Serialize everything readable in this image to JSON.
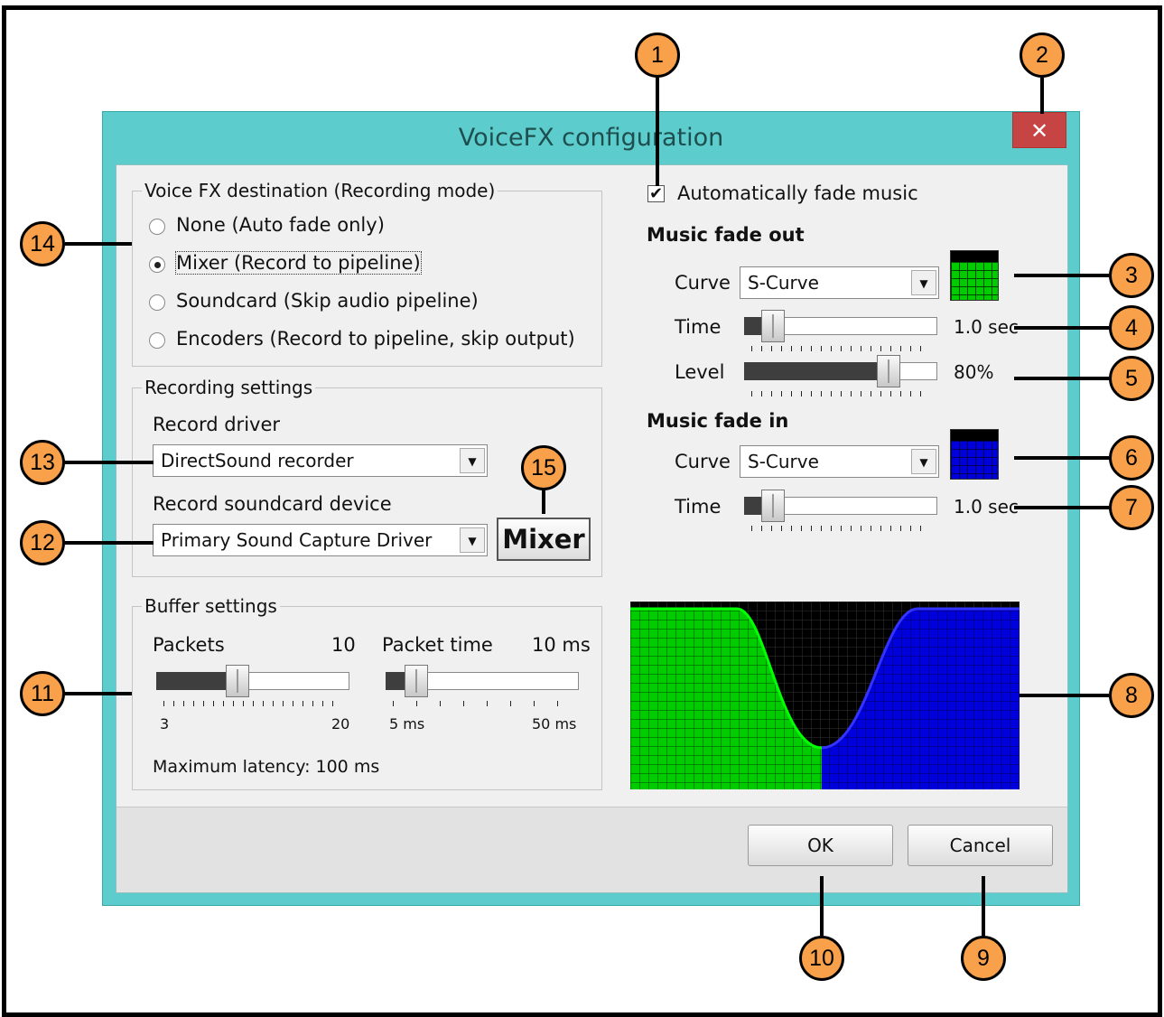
{
  "window": {
    "title": "VoiceFX configuration",
    "close_label": "✕"
  },
  "destination": {
    "label": "Voice FX destination (Recording mode)",
    "options": [
      {
        "label": "None (Auto fade only)",
        "selected": false
      },
      {
        "label": "Mixer (Record to pipeline)",
        "selected": true
      },
      {
        "label": "Soundcard (Skip audio pipeline)",
        "selected": false
      },
      {
        "label": "Encoders (Record to pipeline, skip output)",
        "selected": false
      }
    ]
  },
  "recording": {
    "label": "Recording settings",
    "driver_label": "Record driver",
    "driver_value": "DirectSound recorder",
    "device_label": "Record soundcard device",
    "device_value": "Primary Sound Capture Driver",
    "mixer_label": "Mixer"
  },
  "buffer": {
    "label": "Buffer settings",
    "packets_label": "Packets",
    "packets_value": "10",
    "packets_fraction": 0.41,
    "packets_min": "3",
    "packets_max": "20",
    "packet_time_label": "Packet time",
    "packet_time_value": "10 ms",
    "packet_time_fraction": 0.11,
    "packet_time_min": "5 ms",
    "packet_time_max": "50 ms",
    "latency": "Maximum latency: 100 ms"
  },
  "fade": {
    "auto_label": "Automatically fade music",
    "auto_checked": true,
    "checkmark": "✔",
    "out_header": "Music fade out",
    "out_curve_label": "Curve",
    "out_curve_value": "S-Curve",
    "out_time_label": "Time",
    "out_time_value": "1.0 sec",
    "out_time_fraction": 0.1,
    "out_level_label": "Level",
    "out_level_value": "80%",
    "out_level_fraction": 0.78,
    "in_header": "Music fade in",
    "in_curve_label": "Curve",
    "in_curve_value": "S-Curve",
    "in_time_label": "Time",
    "in_time_value": "1.0 sec",
    "in_time_fraction": 0.1
  },
  "buttons": {
    "ok": "OK",
    "cancel": "Cancel"
  },
  "colors": {
    "fade_out": "#00cc00",
    "fade_in": "#0000dd",
    "window_frame": "#5ccccc",
    "callout": "#f8a04a"
  },
  "icons": {
    "dropdown": "▼"
  },
  "callouts": [
    "1",
    "2",
    "3",
    "4",
    "5",
    "6",
    "7",
    "8",
    "9",
    "10",
    "11",
    "12",
    "13",
    "14",
    "15"
  ]
}
